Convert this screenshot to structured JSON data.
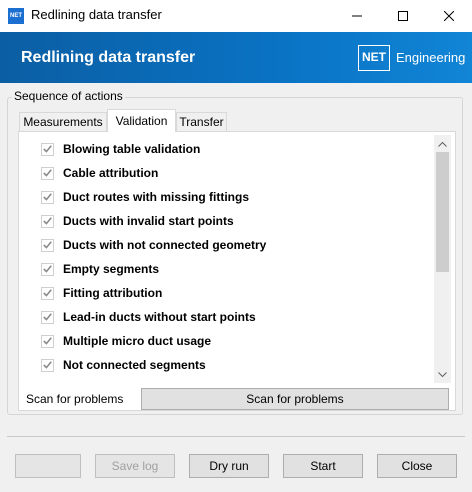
{
  "window": {
    "title": "Redlining data transfer",
    "app_icon_text": "NET"
  },
  "banner": {
    "title": "Redlining data transfer",
    "logo_text": "NET",
    "logo_label": "Engineering",
    "color": "#0a73c4"
  },
  "group": {
    "label": "Sequence of actions"
  },
  "tabs": [
    {
      "label": "Measurements",
      "active": false
    },
    {
      "label": "Validation",
      "active": true
    },
    {
      "label": "Transfer",
      "active": false
    }
  ],
  "validation_items": [
    {
      "label": "Blowing table validation",
      "checked": true
    },
    {
      "label": "Cable attribution",
      "checked": true
    },
    {
      "label": "Duct routes with missing fittings",
      "checked": true
    },
    {
      "label": "Ducts with invalid start points",
      "checked": true
    },
    {
      "label": "Ducts with not connected geometry",
      "checked": true
    },
    {
      "label": "Empty segments",
      "checked": true
    },
    {
      "label": "Fitting attribution",
      "checked": true
    },
    {
      "label": "Lead-in ducts without start points",
      "checked": true
    },
    {
      "label": "Multiple micro duct usage",
      "checked": true
    },
    {
      "label": "Not connected segments",
      "checked": true
    }
  ],
  "scan": {
    "label": "Scan for problems",
    "button": "Scan for problems"
  },
  "footer": {
    "blank_button": "",
    "save_log": "Save log",
    "dry_run": "Dry run",
    "start": "Start",
    "close": "Close"
  }
}
